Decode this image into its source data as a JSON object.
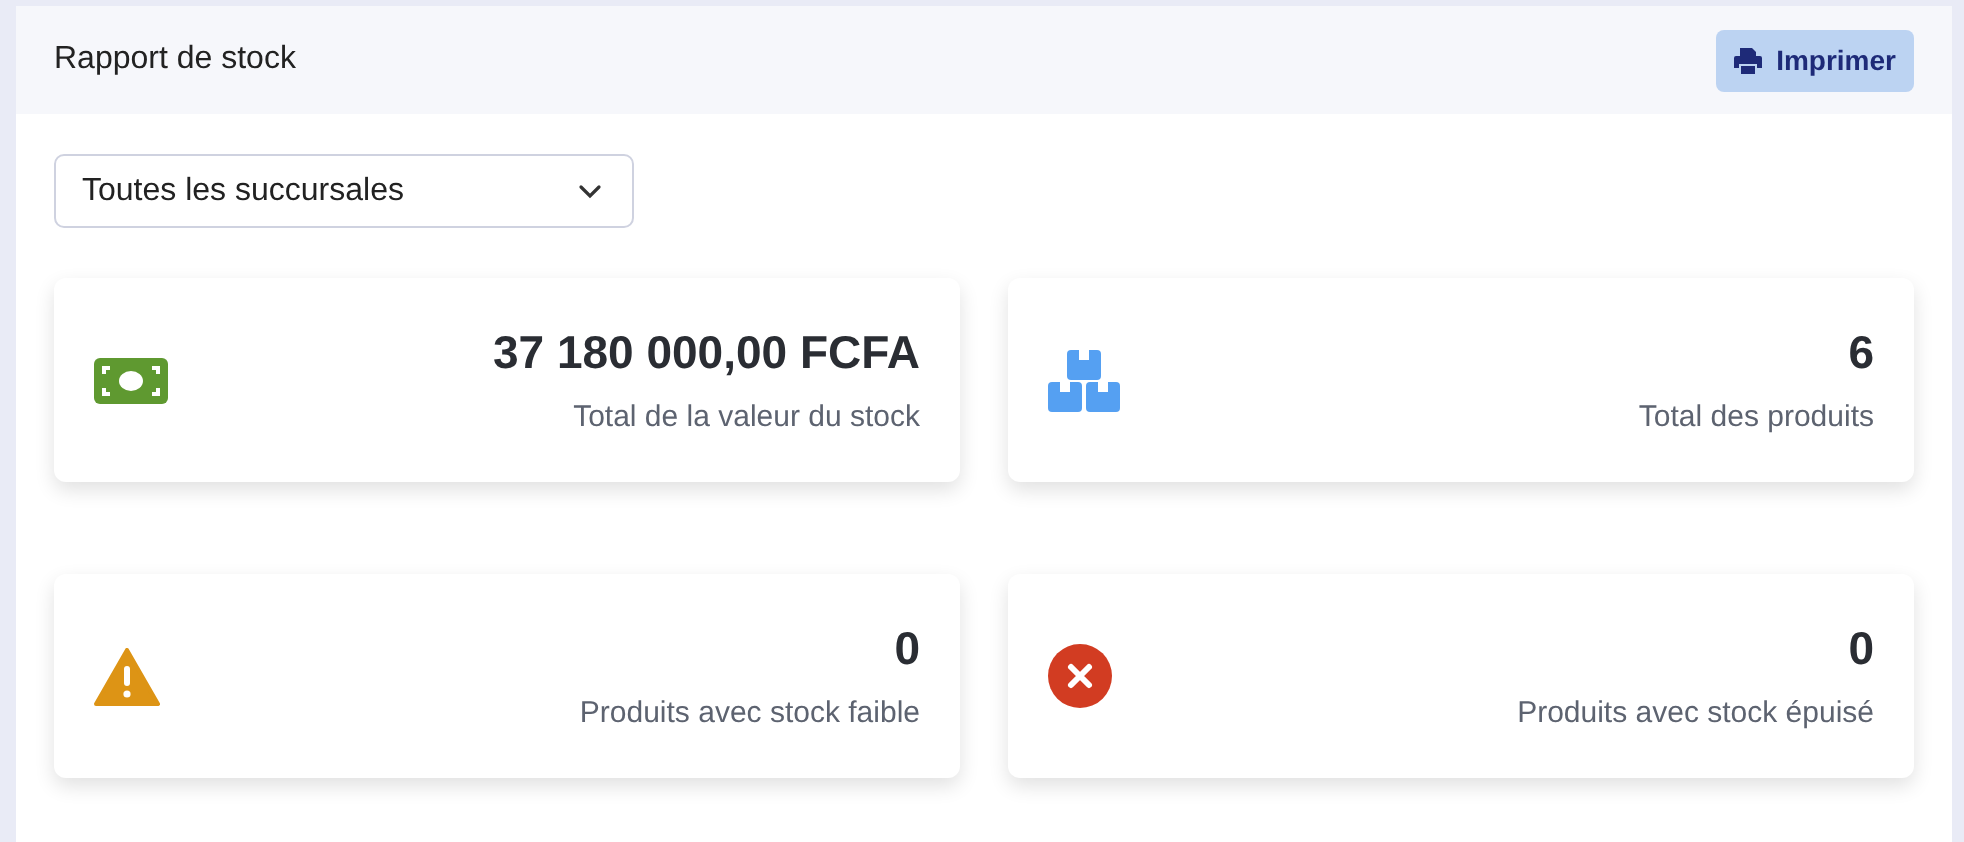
{
  "header": {
    "title": "Rapport de stock",
    "print_button": "Imprimer"
  },
  "branch_select": {
    "value": "Toutes les succursales"
  },
  "cards": [
    {
      "kind": "money",
      "value": "37 180 000,00 FCFA",
      "label": "Total de la valeur du stock"
    },
    {
      "kind": "boxes",
      "value": "6",
      "label": "Total des produits"
    },
    {
      "kind": "warning",
      "value": "0",
      "label": "Produits avec stock faible"
    },
    {
      "kind": "error",
      "value": "0",
      "label": "Produits avec stock épuisé"
    }
  ]
}
